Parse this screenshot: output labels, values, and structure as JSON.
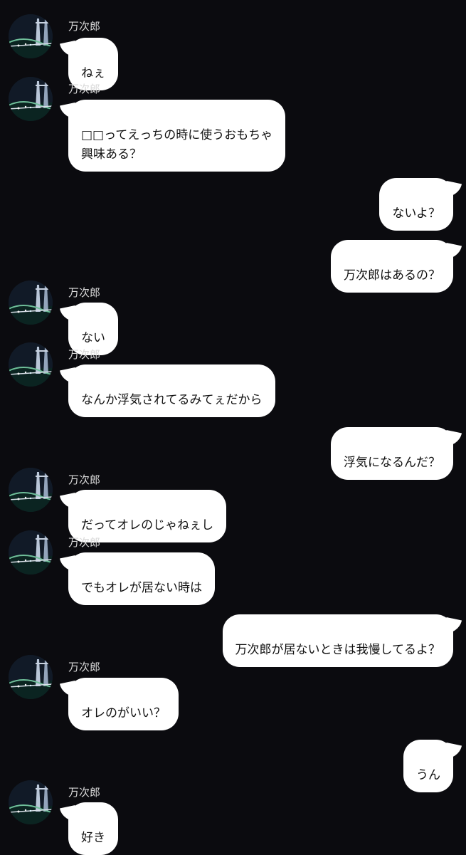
{
  "chat": {
    "contact_name": "万次郎",
    "messages": [
      {
        "side": "in",
        "name": "万次郎",
        "text": "ねぇ"
      },
      {
        "side": "in",
        "name": "万次郎",
        "text": "□□ってえっちの時に使うおもちゃ\n興味ある？"
      },
      {
        "side": "out",
        "text": "ないよ？"
      },
      {
        "side": "out",
        "text": "万次郎はあるの？"
      },
      {
        "side": "in",
        "name": "万次郎",
        "text": "ない"
      },
      {
        "side": "in",
        "name": "万次郎",
        "text": "なんか浮気されてるみてぇだから"
      },
      {
        "side": "out",
        "text": "浮気になるんだ？"
      },
      {
        "side": "in",
        "name": "万次郎",
        "text": "だってオレのじゃねぇし"
      },
      {
        "side": "in",
        "name": "万次郎",
        "text": "でもオレが居ない時は"
      },
      {
        "side": "out",
        "text": "万次郎が居ないときは我慢してるよ？"
      },
      {
        "side": "in",
        "name": "万次郎",
        "text": "オレのがいい？"
      },
      {
        "side": "out",
        "text": "うん"
      },
      {
        "side": "in",
        "name": "万次郎",
        "text": "好き"
      }
    ]
  },
  "colors": {
    "background": "#0b0b0f",
    "bubble": "#ffffff",
    "text": "#111111",
    "name": "#d9d9d9"
  }
}
